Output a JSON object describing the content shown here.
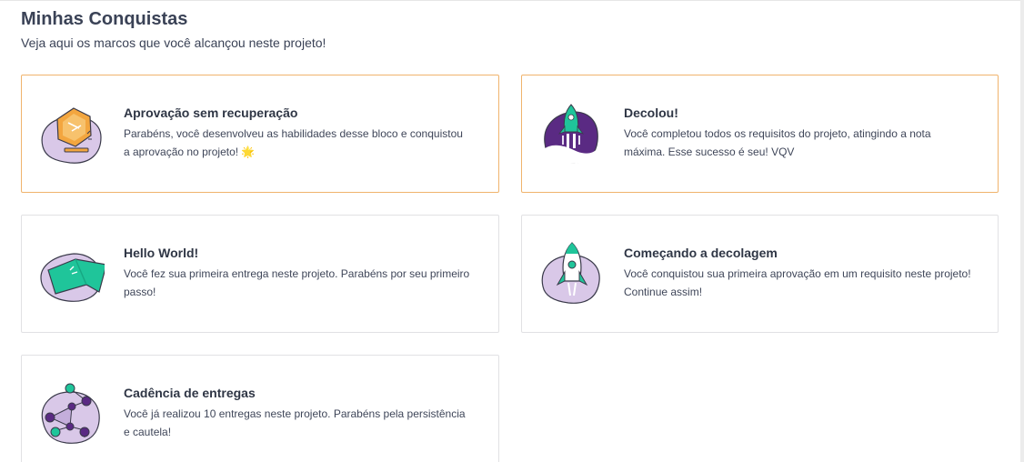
{
  "header": {
    "title": "Minhas Conquistas",
    "subtitle": "Veja aqui os marcos que você alcançou neste projeto!"
  },
  "achievements": [
    {
      "title": "Aprovação sem recuperação",
      "description": "Parabéns, você desenvolveu as habilidades desse bloco e conquistou a aprovação no projeto! 🌟",
      "icon": "gold-medal-icon",
      "highlighted": true
    },
    {
      "title": "Decolou!",
      "description": "Você completou todos os requisitos do projeto, atingindo a nota máxima. Esse sucesso é seu! VQV",
      "icon": "rocket-launch-icon",
      "highlighted": true
    },
    {
      "title": "Hello World!",
      "description": "Você fez sua primeira entrega neste projeto. Parabéns por seu primeiro passo!",
      "icon": "flag-icon",
      "highlighted": false
    },
    {
      "title": "Começando a decolagem",
      "description": "Você conquistou sua primeira aprovação em um requisito neste projeto! Continue assim!",
      "icon": "rocket-icon",
      "highlighted": false
    },
    {
      "title": "Cadência de entregas",
      "description": "Você já realizou 10 entregas neste projeto. Parabéns pela persistência e cautela!",
      "icon": "network-nodes-icon",
      "highlighted": false
    }
  ],
  "colors": {
    "highlight_border": "#f0b46d",
    "card_border": "#e1e1e4",
    "lavender": "#cfbde0",
    "green": "#1fc59a",
    "purple": "#5a2a83",
    "gold": "#f3a63f"
  }
}
